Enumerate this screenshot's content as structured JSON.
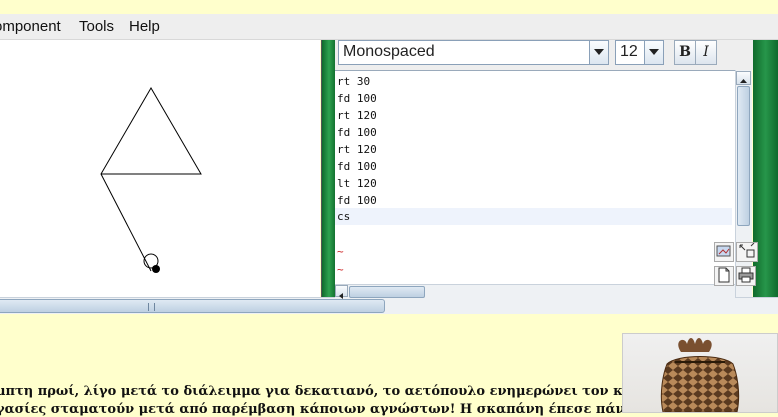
{
  "menubar": {
    "items": [
      "omponent",
      "Tools",
      "Help"
    ]
  },
  "editor": {
    "font_name": "Monospaced",
    "font_size": "12",
    "bold_label": "B",
    "italic_label": "I",
    "lines": [
      "rt 30",
      "fd 100",
      "rt 120",
      "fd 100",
      "rt 120",
      "fd 100",
      "lt 120",
      "fd 100",
      "cs"
    ],
    "empty_marker": "~"
  },
  "article": {
    "line1": "μπτη πρωί, λίγο μετά το διάλειμμα για δεκατιανό, το αετόπουλο ενημερώνει τον κ.",
    "line2": "γασίες σταματούν μετά από παρέμβαση κάποιων αγνώστων! Η σκαπάνη έπεσε πάνω"
  },
  "icons": {
    "turtle": "turtle-cursor-icon",
    "vase": "vase-photo"
  }
}
